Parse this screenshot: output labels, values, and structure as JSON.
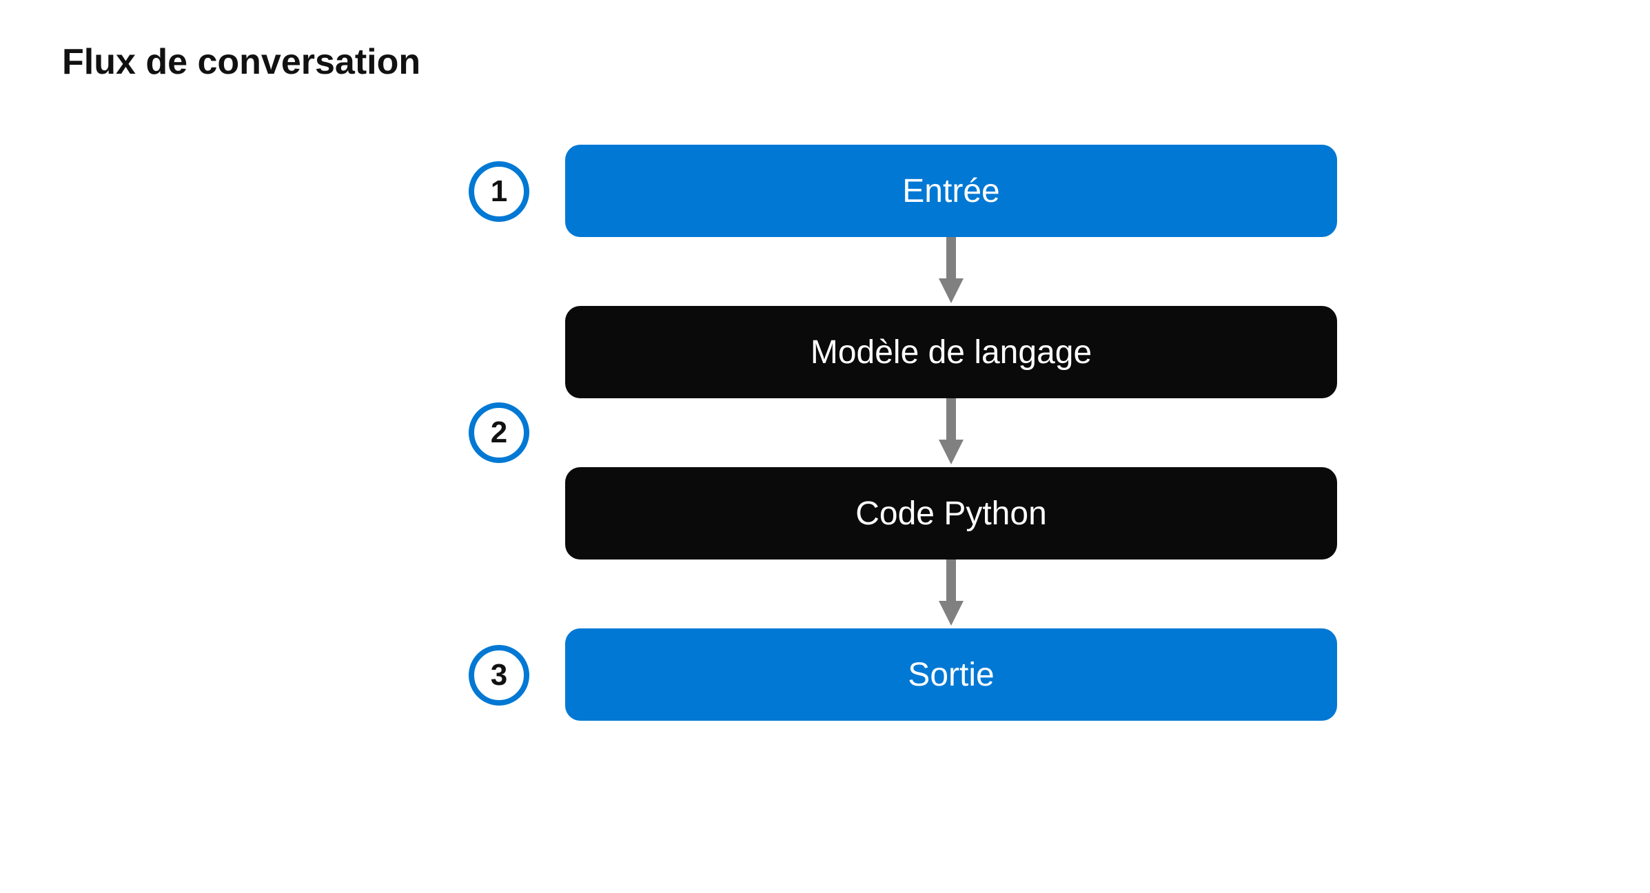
{
  "title": "Flux de conversation",
  "colors": {
    "accent": "#0078d4",
    "nodeDark": "#0a0a0a",
    "arrow": "#808080",
    "text": "#111111"
  },
  "badges": [
    "1",
    "2",
    "3"
  ],
  "nodes": [
    {
      "label": "Entrée",
      "style": "blue"
    },
    {
      "label": "Modèle de langage",
      "style": "black"
    },
    {
      "label": "Code Python",
      "style": "black"
    },
    {
      "label": "Sortie",
      "style": "blue"
    }
  ]
}
